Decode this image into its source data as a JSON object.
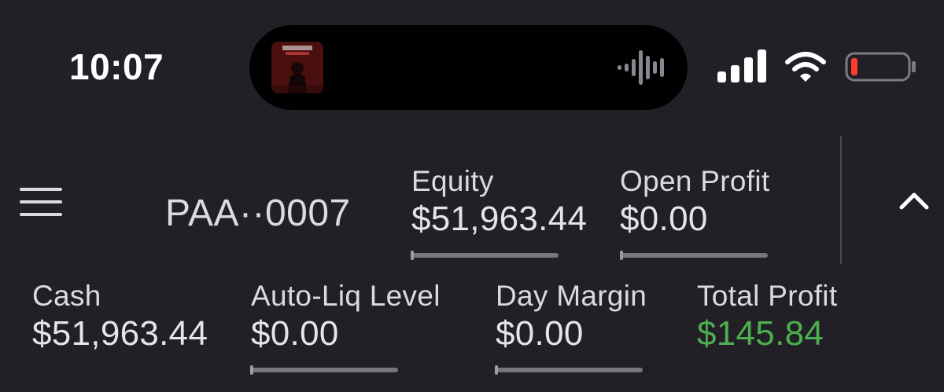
{
  "status_bar": {
    "time": "10:07",
    "now_playing_art_icon": "album-art-icon",
    "audio_indicator_icon": "waveform-icon",
    "signal_icon": "cellular-signal-icon",
    "wifi_icon": "wifi-icon",
    "battery_icon": "battery-low-icon",
    "battery_color": "#ff3b30"
  },
  "header": {
    "menu_icon": "hamburger-menu-icon",
    "account_id": "PAA··0007",
    "collapse_icon": "chevron-up-icon"
  },
  "metrics": {
    "equity": {
      "label": "Equity",
      "value": "$51,963.44"
    },
    "open_profit": {
      "label": "Open Profit",
      "value": "$0.00"
    },
    "cash": {
      "label": "Cash",
      "value": "$51,963.44"
    },
    "auto_liq_level": {
      "label": "Auto-Liq Level",
      "value": "$0.00"
    },
    "day_margin": {
      "label": "Day Margin",
      "value": "$0.00"
    },
    "total_profit": {
      "label": "Total Profit",
      "value": "$145.84"
    }
  },
  "colors": {
    "background": "#222026",
    "text": "#dcdadf",
    "profit_positive": "#4caf50"
  }
}
